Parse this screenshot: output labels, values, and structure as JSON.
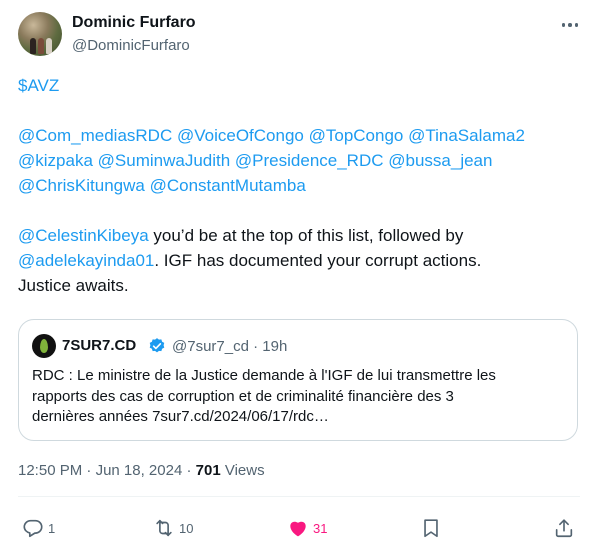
{
  "author": {
    "name": "Dominic Furfaro",
    "handle": "@DominicFurfaro",
    "avatar_icon": "profile-photo"
  },
  "tweet": {
    "cashtag": "$AVZ",
    "mentions_line1": [
      "@Com_mediasRDC",
      "@VoiceOfCongo",
      "@TopCongo",
      "@TinaSalama2"
    ],
    "mentions_line2": [
      "@kizpaka",
      "@SuminwaJudith",
      "@Presidence_RDC",
      "@bussa_jean"
    ],
    "mentions_line3": [
      "@ChrisKitungwa",
      "@ConstantMutamba"
    ],
    "para_mention1": "@CelestinKibeya",
    "para_text1": " you’d be at the top of this list, followed by",
    "para_mention2": "@adelekayinda01",
    "para_text2": ". IGF has documented your corrupt actions.",
    "para_text3": "Justice awaits."
  },
  "quote": {
    "name": "7SUR7.CD",
    "handle": "@7sur7_cd",
    "time": "19h",
    "text_line1": "RDC : Le ministre de la Justice demande à l'IGF de lui transmettre les",
    "text_line2": "rapports des cas de corruption et de criminalité financière des 3",
    "text_line3": "dernières années 7sur7.cd/2024/06/17/rdc…"
  },
  "meta": {
    "time": "12:50 PM",
    "date": "Jun 18, 2024",
    "views_count": "701",
    "views_label": "Views"
  },
  "actions": {
    "replies": "1",
    "retweets": "10",
    "likes": "31"
  },
  "colors": {
    "link": "#1d9bf0",
    "secondary": "#536471",
    "like": "#f91880",
    "verified_badge": "#1d9bf0"
  }
}
